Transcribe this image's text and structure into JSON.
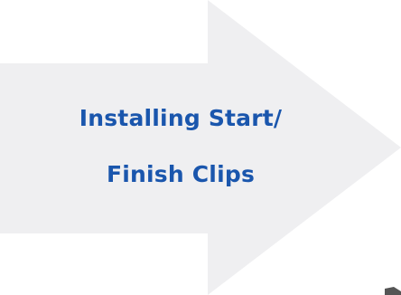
{
  "arrow": {
    "fill_color": "#efeff1",
    "direction": "right"
  },
  "label": {
    "line1": "Installing Start/",
    "line2": "Finish Clips",
    "color": "#1a56ad"
  },
  "corner_mark": {
    "color": "#555555"
  }
}
